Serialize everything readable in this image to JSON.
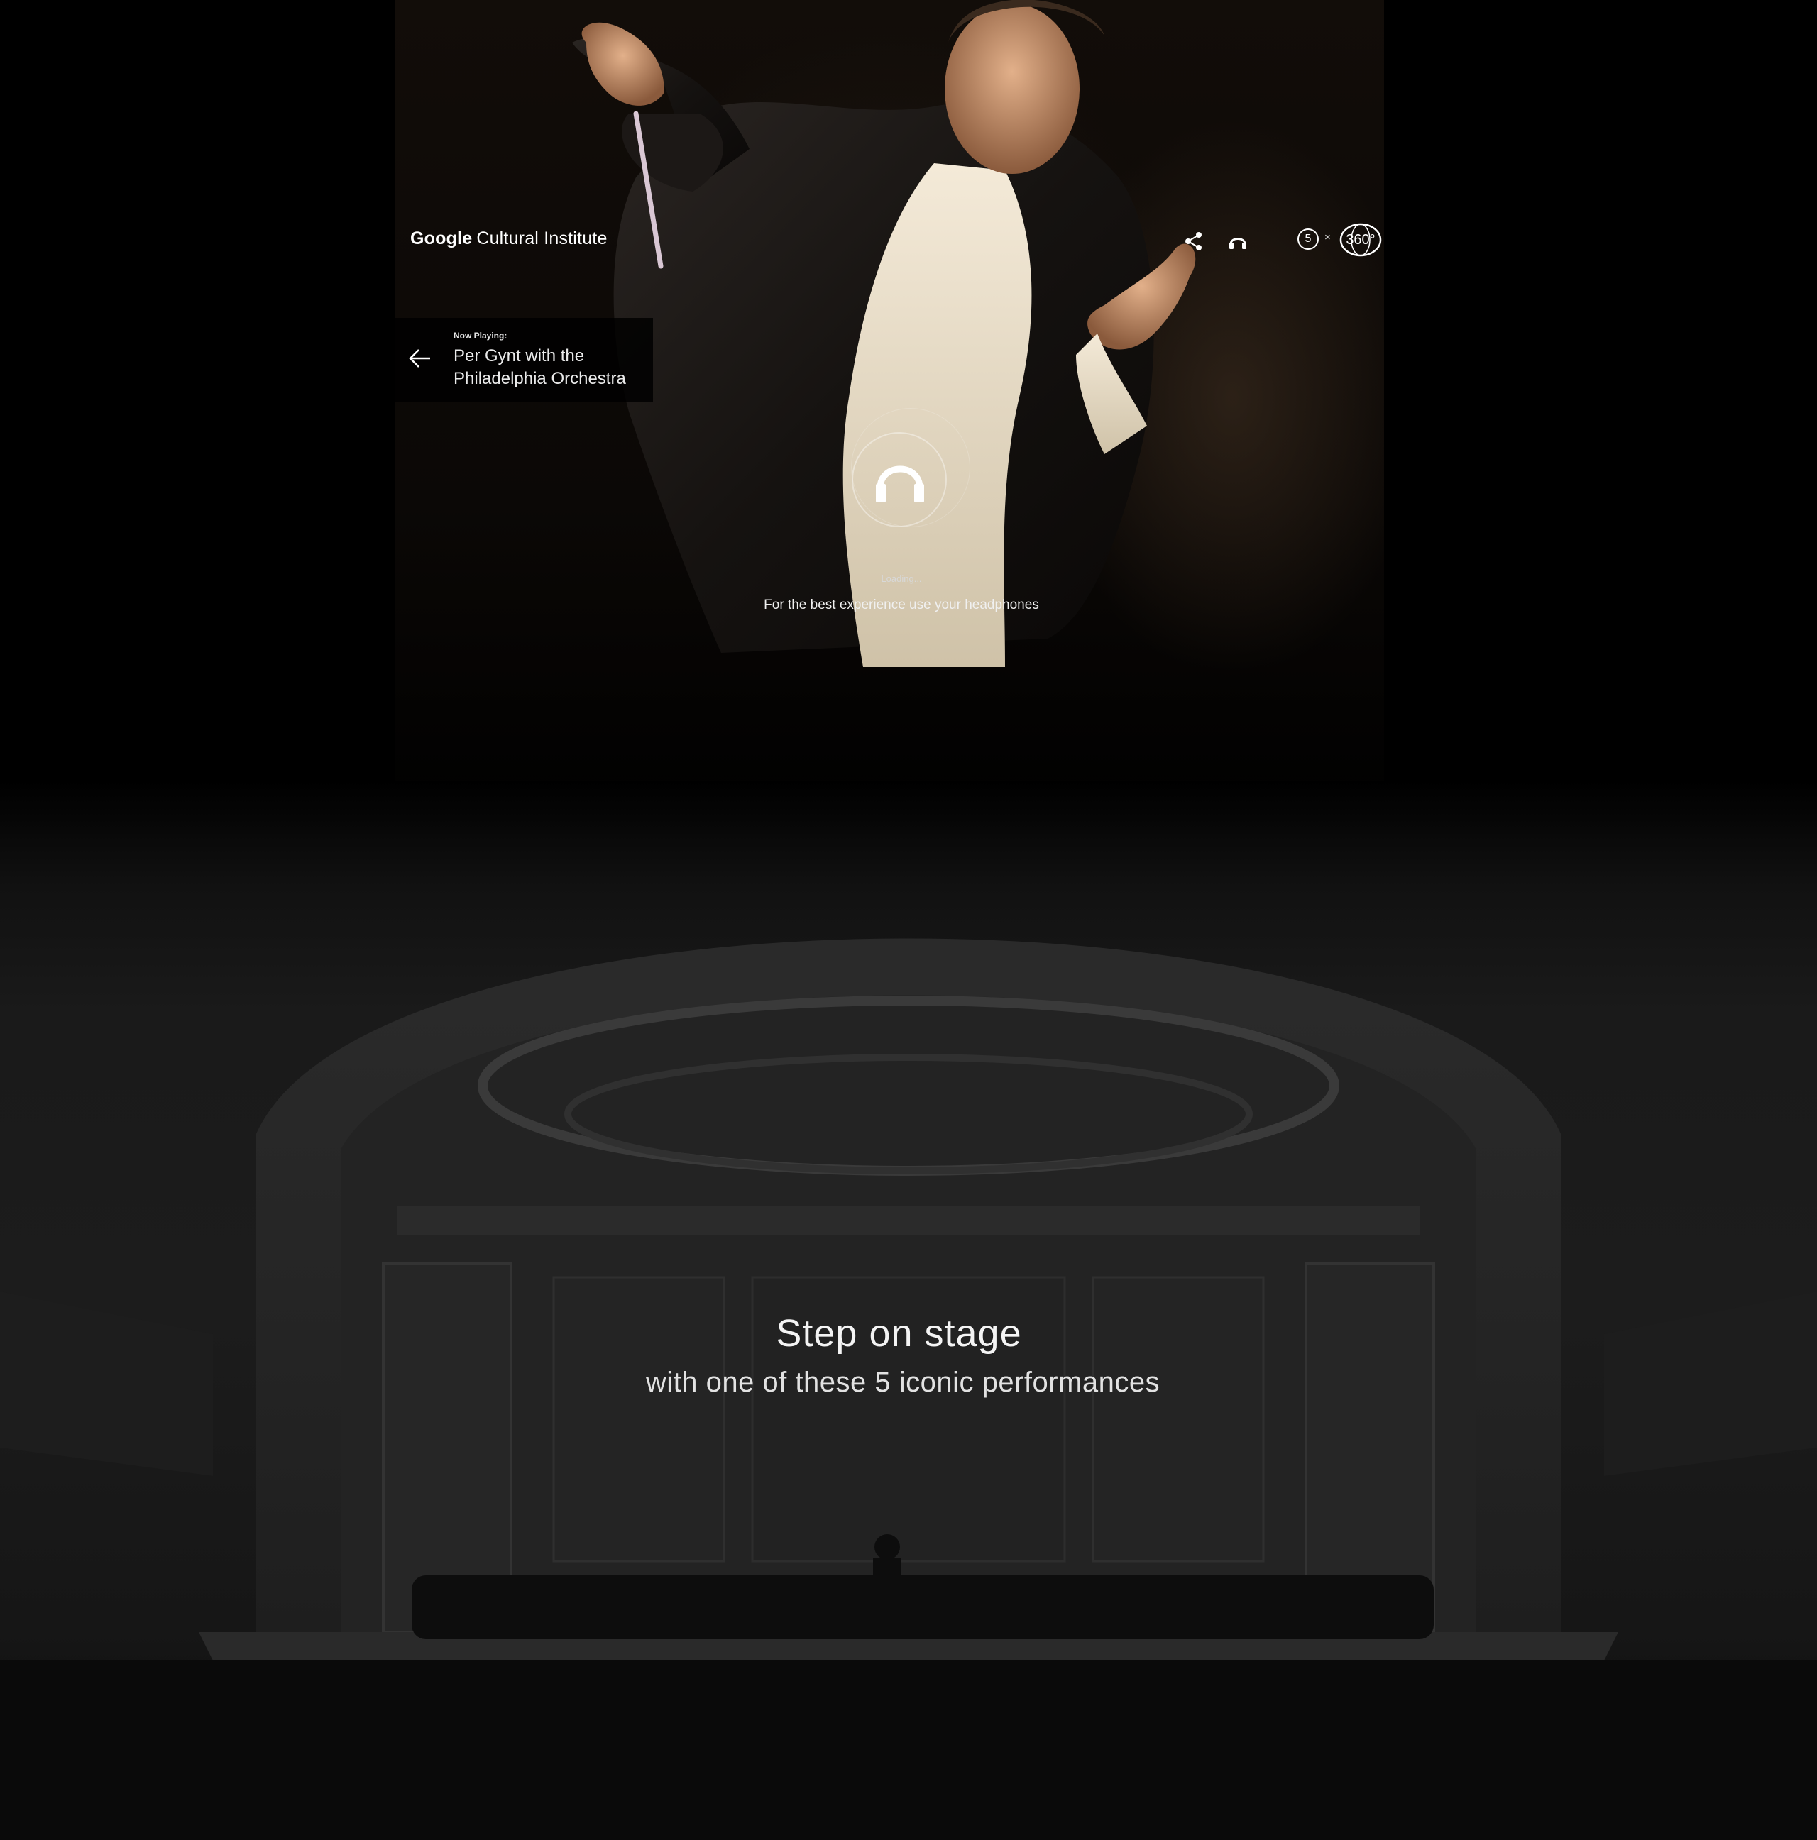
{
  "header": {
    "logo_google": "Google",
    "logo_rest": "Cultural Institute",
    "performances_count": "5",
    "times_sign": "×",
    "badge_360": "360°"
  },
  "now_playing": {
    "label": "Now Playing:",
    "title": "Per Gynt with the Philadelphia Orchestra"
  },
  "loader": {
    "status": "Loading...",
    "hint": "For the best experience use your headphones"
  },
  "hall": {
    "title": "Step on stage",
    "subtitle": "with one of these 5 iconic performances"
  },
  "icons": {
    "share": "share-icon",
    "headphones": "headphones-icon",
    "back": "arrow-left-icon",
    "loader": "headphones-icon"
  },
  "colors": {
    "background": "#000000",
    "text": "#ffffff",
    "hall_tint": "#1c1c1c"
  }
}
